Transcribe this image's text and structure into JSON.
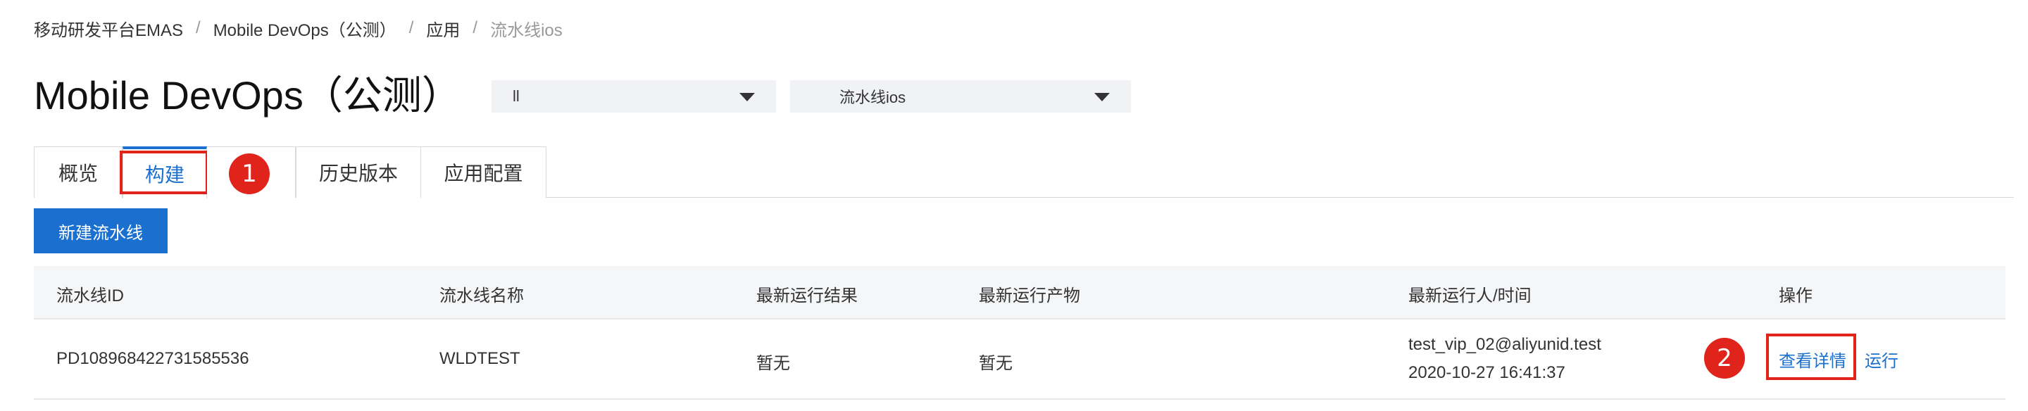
{
  "breadcrumb": {
    "items": [
      "移动研发平台EMAS",
      "Mobile DevOps（公测）",
      "应用"
    ],
    "current": "流水线ios"
  },
  "page_title": "Mobile DevOps（公测）",
  "selects": {
    "app_value": "ll",
    "pipeline_value": "流水线ios"
  },
  "tabs": [
    "概览",
    "构建",
    "历史版本",
    "应用配置"
  ],
  "active_tab": "构建",
  "annotations": {
    "first": "1",
    "second": "2"
  },
  "new_pipeline_button": "新建流水线",
  "table": {
    "headers": [
      "流水线ID",
      "流水线名称",
      "最新运行结果",
      "最新运行产物",
      "最新运行人/时间",
      "操作"
    ],
    "rows": [
      {
        "id": "PD108968422731585536",
        "name": "WLDTEST",
        "result": "暂无",
        "artifact": "暂无",
        "runner": "test_vip_02@aliyunid.test",
        "time": "2020-10-27 16:41:37",
        "actions": {
          "view_details": "查看详情",
          "run": "运行"
        }
      }
    ]
  },
  "colors": {
    "accent": "#1a6fcf",
    "annotation": "#e0241b",
    "header_bg": "#f5f6f8",
    "select_bg": "#f0f2f5"
  }
}
